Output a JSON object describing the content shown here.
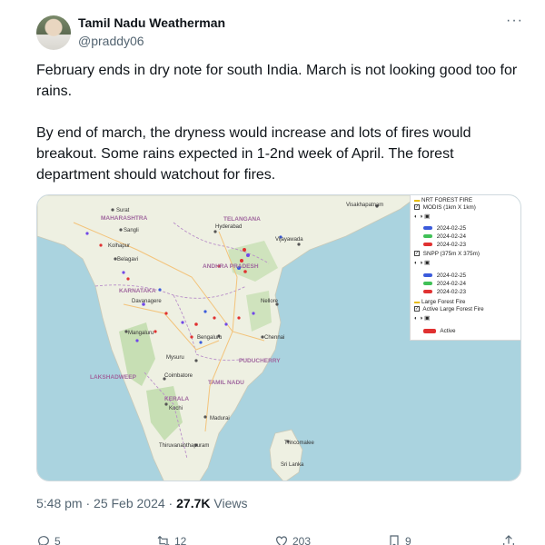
{
  "author": {
    "name": "Tamil Nadu Weatherman",
    "handle": "@praddy06"
  },
  "more_label": "···",
  "tweet_text": {
    "paragraph1": "February ends in dry note for south India. March is not looking good too for rains.",
    "paragraph2": "By end of march, the dryness would increase and lots of fires would breakout. Some rains expected in 1-2nd week of April.  The forest department should watchout for fires."
  },
  "map": {
    "labels": {
      "surat": "Surat",
      "maharashtra": "MAHARASHTRA",
      "sangli": "Sangli",
      "kolhapur": "Kolhapur",
      "belagavi": "Belagavi",
      "karnataka": "KARNATAKA",
      "davanagere": "Davanagere",
      "mangaluru": "Mangaluru",
      "mysuru": "Mysuru",
      "lakshadweep": "LAKSHADWEEP",
      "kerala": "KERALA",
      "kochi": "Kochi",
      "thiruvananthapuram": "Thiruvananthapuram",
      "telangana": "TELANGANA",
      "hyderabad": "Hyderabad",
      "andhra": "ANDHRA PRADESH",
      "vijayawada": "Vijayawada",
      "visakhapatnam": "Visakhapatnam",
      "nellore": "Nellore",
      "bengaluru": "Bengaluru",
      "chennai": "Chennai",
      "puducherry": "PUDUCHERRY",
      "tamilnadu": "TAMIL NADU",
      "coimbatore": "Coimbatore",
      "madurai": "Madurai",
      "trincomalee": "Trincomalee",
      "srilanka": "Sri Lanka"
    },
    "legend": {
      "title": "NRT FOREST FIRE",
      "modis": "MODIS (1km X 1km)",
      "snpp": "SNPP (375m X 375m)",
      "dates": [
        "2024-02-25",
        "2024-02-24",
        "2024-02-23"
      ],
      "date_colors": [
        "#3b5bdb",
        "#40c057",
        "#e03131"
      ],
      "large_fire": "Large Forest Fire",
      "active_large": "Active Large Forest Fire",
      "active": "Active",
      "active_color": "#e03131"
    }
  },
  "meta": {
    "time": "5:48 pm",
    "separator": " · ",
    "date": "25 Feb 2024",
    "views_count": "27.7K",
    "views_label": " Views"
  },
  "actions": {
    "reply": "5",
    "retweet": "12",
    "like": "203",
    "bookmark": "9"
  }
}
